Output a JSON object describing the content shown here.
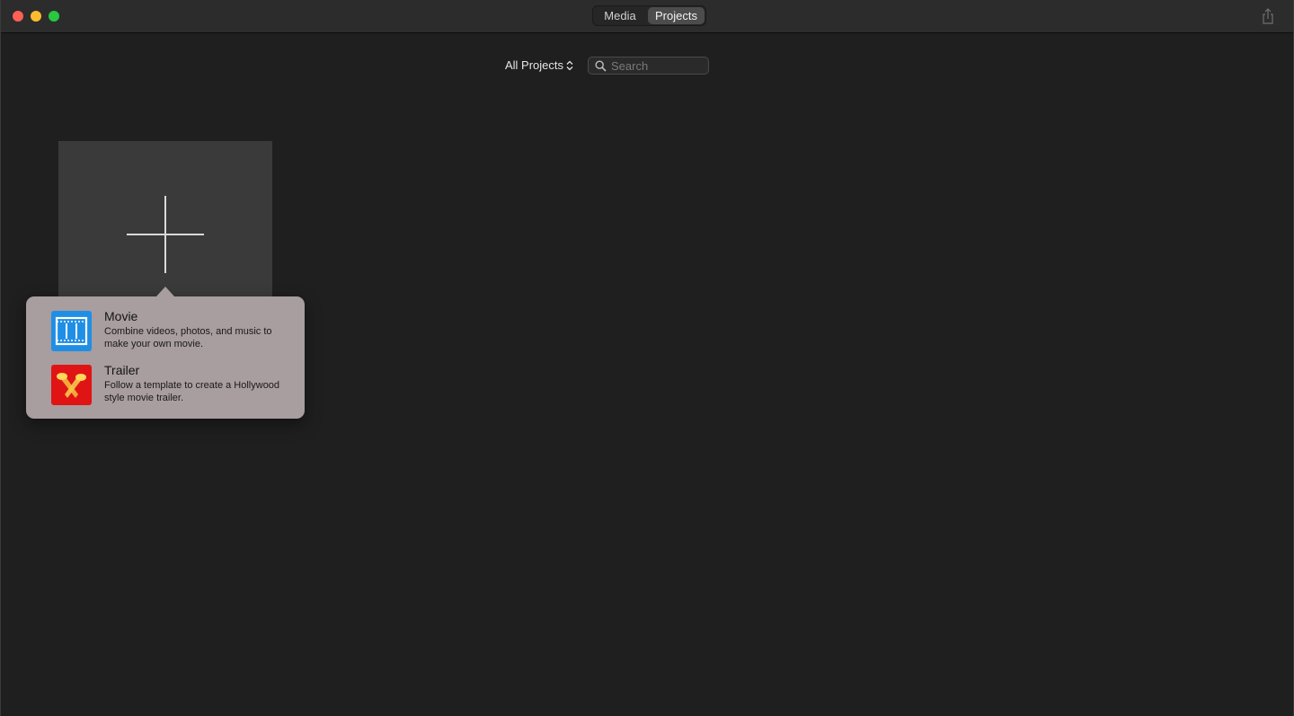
{
  "window": {
    "tabs": [
      {
        "label": "Media",
        "active": false
      },
      {
        "label": "Projects",
        "active": true
      }
    ]
  },
  "toolbar": {
    "filter_label": "All Projects",
    "search_placeholder": "Search"
  },
  "popover": {
    "options": [
      {
        "title": "Movie",
        "description": "Combine videos, photos, and music to make your own movie.",
        "icon": "film-strip-icon"
      },
      {
        "title": "Trailer",
        "description": "Follow a template to create a Hollywood style movie trailer.",
        "icon": "spotlights-icon"
      }
    ]
  },
  "colors": {
    "background": "#1f1f1f",
    "titlebar": "#2c2c2c",
    "popover": "#a89d9f",
    "movie_icon": "#1f8fe6",
    "trailer_icon": "#e01414"
  }
}
